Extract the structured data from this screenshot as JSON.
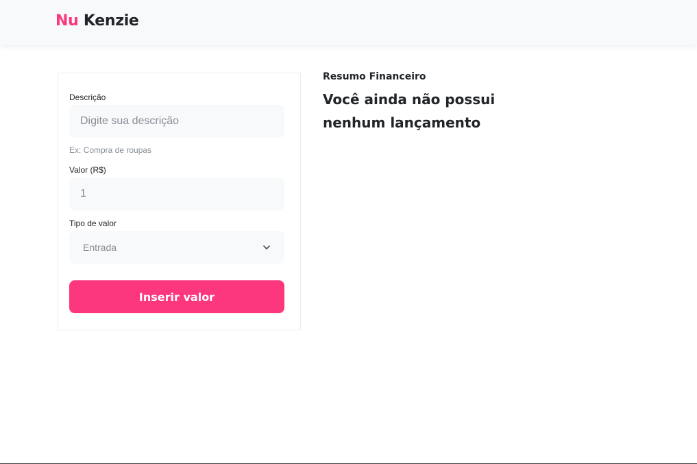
{
  "header": {
    "logo_part1": "Nu",
    "logo_part2": "Kenzie",
    "brand_color": "#fd377e"
  },
  "form": {
    "description_label": "Descrição",
    "description_placeholder": "Digite sua descrição",
    "description_hint": "Ex: Compra de roupas",
    "value_label": "Valor (R$)",
    "value_current": "1",
    "type_label": "Tipo de valor",
    "type_selected": "Entrada",
    "submit_label": "Inserir valor",
    "chevron_icon": "chevron-down-icon"
  },
  "summary": {
    "title": "Resumo Financeiro",
    "empty_message": "Você ainda não possui nenhum lançamento"
  }
}
